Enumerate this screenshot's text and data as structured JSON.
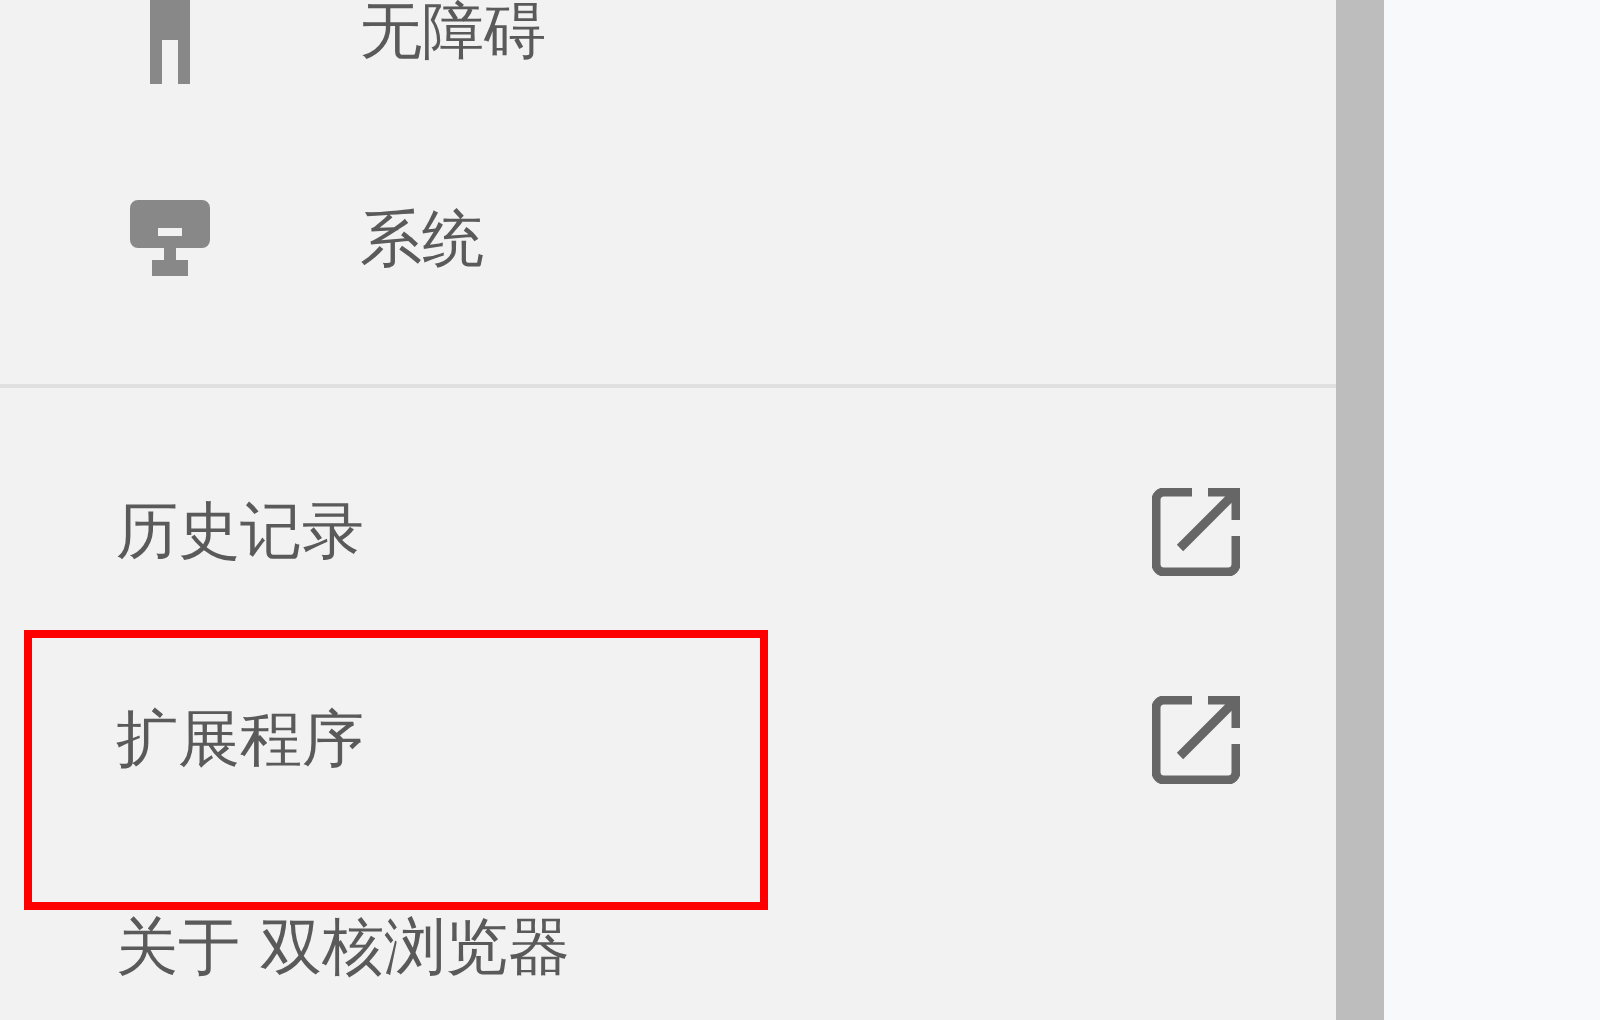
{
  "sidebar": {
    "sections": [
      {
        "items": [
          {
            "kind": "accessibility",
            "label": "无障碍"
          },
          {
            "kind": "system",
            "label": "系统"
          }
        ]
      },
      {
        "items": [
          {
            "kind": "link",
            "label": "历史记录",
            "highlighted": false
          },
          {
            "kind": "link",
            "label": "扩展程序",
            "highlighted": true
          },
          {
            "kind": "plain",
            "label": "关于 双核浏览器",
            "highlighted": false
          }
        ]
      }
    ]
  }
}
